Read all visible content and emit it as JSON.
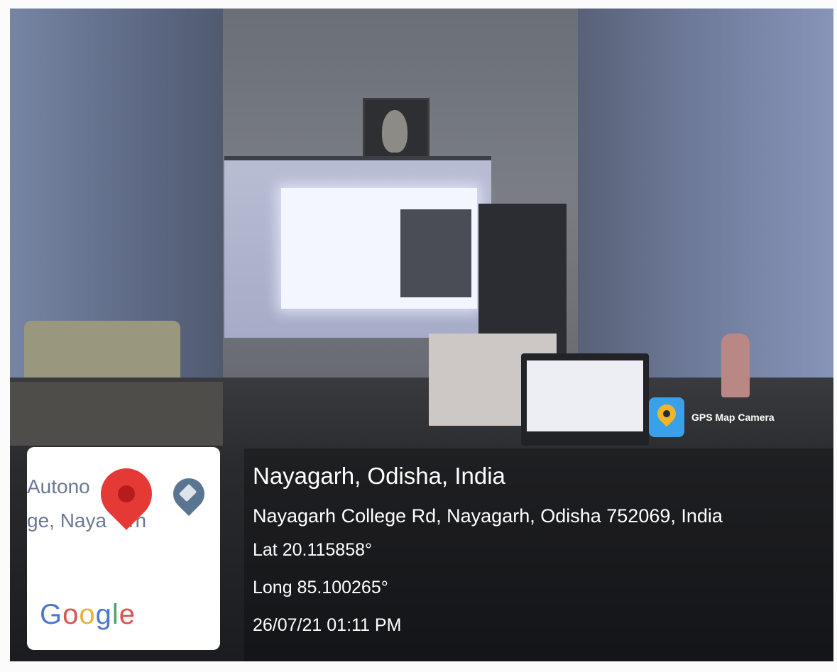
{
  "badge": {
    "label": "GPS Map Camera",
    "icon": "gps-map-camera-icon"
  },
  "map": {
    "line1": "Autono      s",
    "line2": "ge, Naya    rh",
    "brand_letters": [
      "G",
      "o",
      "o",
      "g",
      "l",
      "e"
    ],
    "pin_icon": "location-pin-icon",
    "place_icon": "school-pin-icon"
  },
  "location": {
    "city": "Nayagarh, Odisha, India",
    "address": "Nayagarh College Rd, Nayagarh, Odisha 752069, India",
    "lat": "Lat 20.115858°",
    "long": "Long 85.100265°",
    "datetime": "26/07/21 01:11 PM"
  },
  "colors": {
    "pin": "#e53935",
    "badge_bg": "#3aa1e8",
    "overlay_text": "#ffffff"
  }
}
